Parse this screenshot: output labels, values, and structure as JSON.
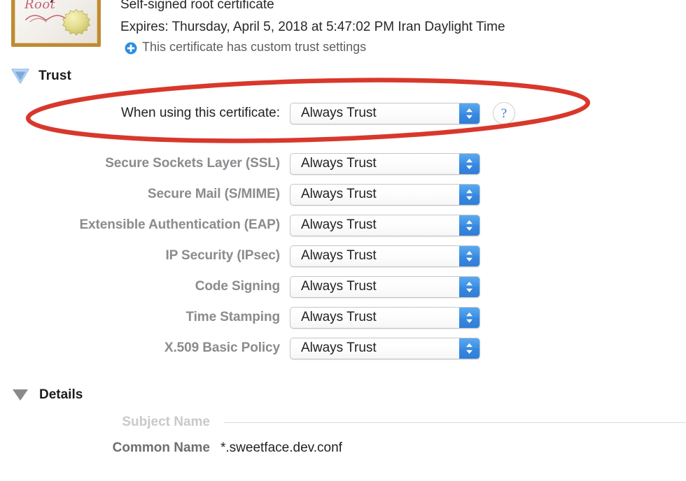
{
  "header": {
    "cert_kind": "Self-signed root certificate",
    "expires": "Expires: Thursday, April 5, 2018 at 5:47:02 PM Iran Daylight Time",
    "custom_trust_note": "This certificate has custom trust settings",
    "custom_trust_icon": "plus-circle-icon",
    "icon": {
      "name": "certificate-icon",
      "word": "Root",
      "frame_color": "#c08b34",
      "seal_color": "#ded98a"
    }
  },
  "trust": {
    "heading": "Trust",
    "disclosure_icon": "disclosure-triangle-down-icon",
    "disclosure_color": "#9fc4ef",
    "help_icon": "question-mark-icon",
    "help_glyph": "?",
    "primary_row": {
      "label": "When using this certificate:",
      "value": "Always Trust"
    },
    "rows": [
      {
        "label": "Secure Sockets Layer (SSL)",
        "value": "Always Trust"
      },
      {
        "label": "Secure Mail (S/MIME)",
        "value": "Always Trust"
      },
      {
        "label": "Extensible Authentication (EAP)",
        "value": "Always Trust"
      },
      {
        "label": "IP Security (IPsec)",
        "value": "Always Trust"
      },
      {
        "label": "Code Signing",
        "value": "Always Trust"
      },
      {
        "label": "Time Stamping",
        "value": "Always Trust"
      },
      {
        "label": "X.509 Basic Policy",
        "value": "Always Trust"
      }
    ]
  },
  "details": {
    "heading": "Details",
    "disclosure_icon": "disclosure-triangle-down-icon",
    "disclosure_color": "#8a8a8a",
    "subject_name_label": "Subject Name",
    "common_name_label": "Common Name",
    "common_name_value": "*.sweetface.dev.conf"
  },
  "annotation": {
    "shape": "ellipse",
    "color": "#d8382c",
    "stroke_width": 6,
    "target": "when-using-this-certificate-row"
  },
  "colors": {
    "accent_blue": "#3888e0",
    "annotation_red": "#d8382c",
    "secondary_label": "#8b8b8f",
    "muted_label": "#c9c9cb"
  }
}
